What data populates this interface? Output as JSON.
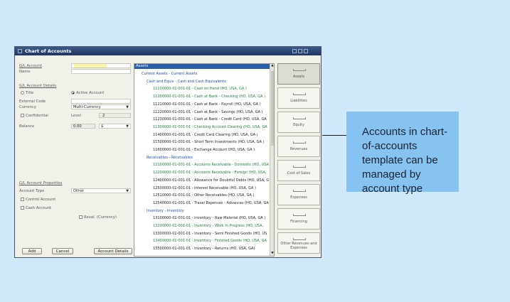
{
  "window": {
    "title": "Chart of Accounts"
  },
  "form": {
    "gl_account_label": "G/L Account",
    "gl_account_value": "",
    "name_label": "Name",
    "name_value": "",
    "details_header": "G/L Account Details",
    "title_option": "Title",
    "active_option": "Active Account",
    "external_code_label": "External Code",
    "currency_label": "Currency",
    "currency_value": "Multi-Currency",
    "confidential_label": "Confidential",
    "level_label": "Level",
    "level_value": "2",
    "balance_label": "Balance",
    "balance_value": "0.00",
    "balance_currency": "$",
    "properties_header": "G/L Account Properties",
    "account_type_label": "Account Type",
    "account_type_value": "Other",
    "control_account_label": "Control Account",
    "cash_account_label": "Cash Account",
    "reval_label": "Reval. (Currency)"
  },
  "buttons": {
    "add": "Add",
    "cancel": "Cancel",
    "account_details": "Account Details"
  },
  "tree": {
    "header": "Assets",
    "rows": [
      {
        "text": "Current Assets - Current Assets",
        "kind": "title1"
      },
      {
        "text": "Cash and Equiv - Cash and Cash Equivalents",
        "kind": "title2"
      },
      {
        "text": "11100000-01-001-01 - Cash on Hand (HO, USA, GA )",
        "kind": "green"
      },
      {
        "text": "11200000-01-001-01 - Cash at Bank - Checking (HO, USA, GA )",
        "kind": "green"
      },
      {
        "text": "11210000-01-001-01 - Cash at Bank - Payroll (HO, USA, GA )",
        "kind": "dark"
      },
      {
        "text": "11220000-01-001-01 - Cash at Bank - Savings (HO, USA, GA )",
        "kind": "dark"
      },
      {
        "text": "11230000-01-001-01 - Cash at Bank - Credit Card (HO, USA, GA",
        "kind": "dark"
      },
      {
        "text": "11300000-01-001-01 - Checking Account Clearing (HO, USA, GA",
        "kind": "green"
      },
      {
        "text": "11400000-01-001-01 - Credit Card Clearing (HO, USA, GA )",
        "kind": "dark"
      },
      {
        "text": "11500000-01-001-01 - Short Term Investments (HO, USA, GA )",
        "kind": "dark"
      },
      {
        "text": "11600000-01-001-01 - Exchange Account (HO, USA, GA )",
        "kind": "dark"
      },
      {
        "text": "Receivables - Receivables",
        "kind": "title2"
      },
      {
        "text": "12100000-01-001-01 - Accounts Receivable - Domestic (HO, USA",
        "kind": "green"
      },
      {
        "text": "12200000-01-001-01 - Accounts Receivable - Foreign (HO, USA,",
        "kind": "green"
      },
      {
        "text": "12400000-01-001-01 - Allowance for Doubtful Debts (HO, USA, G",
        "kind": "dark"
      },
      {
        "text": "12500000-01-001-01 - Interest Receivable (HO, USA, GA )",
        "kind": "dark"
      },
      {
        "text": "12510000-01-001-01 - Other Receivables (HO, USA, GA )",
        "kind": "dark"
      },
      {
        "text": "12540000-01-001-01 - Travel Expenses - Advances (HO, USA, GA",
        "kind": "dark"
      },
      {
        "text": "Inventory - Inventory",
        "kind": "title2"
      },
      {
        "text": "13100000-01-001-01 - Inventory - Raw Material (HO, USA, GA )",
        "kind": "dark"
      },
      {
        "text": "13200000-01-001-01 - Inventory - Work In Progress (HO, USA,",
        "kind": "green"
      },
      {
        "text": "13300000-01-001-01 - Inventory - Semi Finished Goods (HO, US",
        "kind": "dark"
      },
      {
        "text": "13400000-01-001-01 - Inventory - Finished Goods (HO, USA, GA",
        "kind": "green"
      },
      {
        "text": "13500000-01-001-01 - Inventory - Returns (HO, USA, GA)",
        "kind": "dark"
      }
    ]
  },
  "tabs": [
    {
      "label": "Assets",
      "active": true
    },
    {
      "label": "Liabilities",
      "active": false
    },
    {
      "label": "Equity",
      "active": false
    },
    {
      "label": "Revenues",
      "active": false
    },
    {
      "label": "Cost of Sales",
      "active": false
    },
    {
      "label": "Expenses",
      "active": false
    },
    {
      "label": "Financing",
      "active": false
    },
    {
      "label": "Other Revenues and Expenses",
      "active": false
    }
  ],
  "callout": {
    "text": "Accounts in chart-of-accounts template can be managed by account type"
  },
  "colors": {
    "background": "#cfe9fa",
    "callout": "#86c3f0",
    "tree_header": "#2a5ea9",
    "gl_input": "#fbf3a8"
  }
}
